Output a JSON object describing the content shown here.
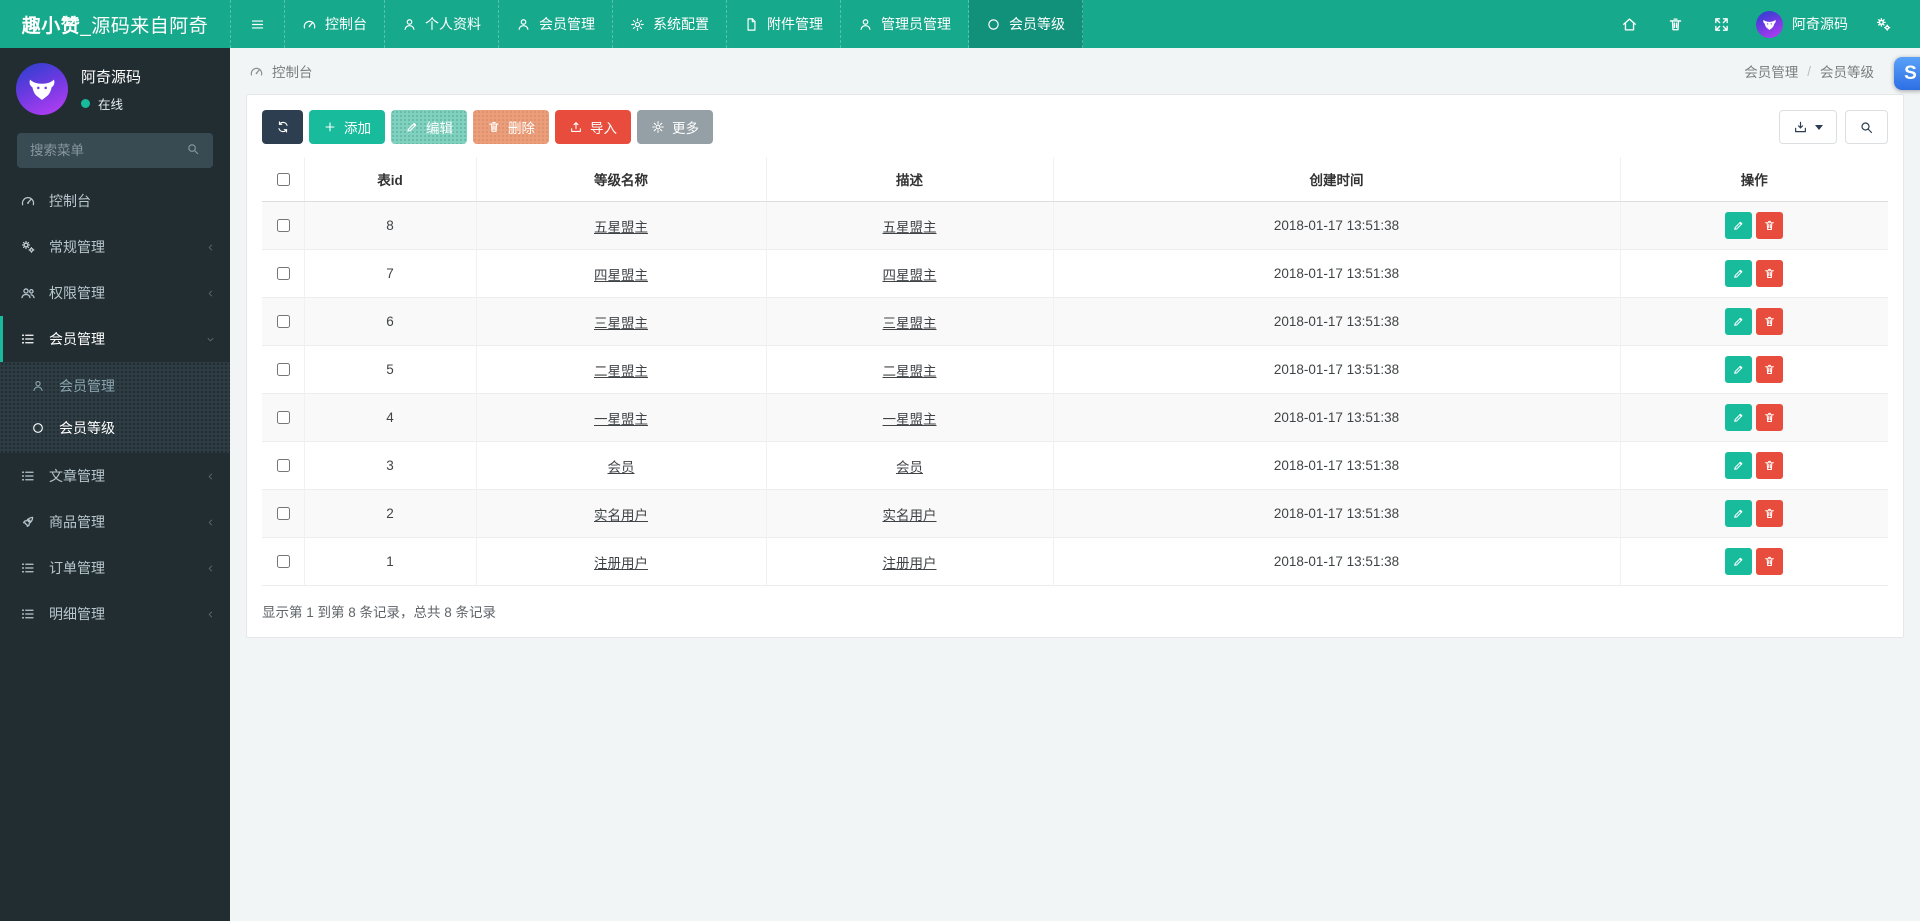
{
  "navbar": {
    "logo_bold": "趣小赞",
    "logo_rest": "_源码来自阿奇",
    "items": [
      {
        "label": "控制台",
        "icon": "dashboard",
        "active": false
      },
      {
        "label": "个人资料",
        "icon": "user",
        "active": false
      },
      {
        "label": "会员管理",
        "icon": "user",
        "active": false
      },
      {
        "label": "系统配置",
        "icon": "gear",
        "active": false
      },
      {
        "label": "附件管理",
        "icon": "file",
        "active": false
      },
      {
        "label": "管理员管理",
        "icon": "user",
        "active": false
      },
      {
        "label": "会员等级",
        "icon": "circle",
        "active": true
      }
    ],
    "user_name": "阿奇源码"
  },
  "sidebar": {
    "user_name": "阿奇源码",
    "user_status": "在线",
    "search_placeholder": "搜索菜单",
    "menu": [
      {
        "label": "控制台",
        "icon": "dashboard"
      },
      {
        "label": "常规管理",
        "icon": "gears",
        "chevron": "left"
      },
      {
        "label": "权限管理",
        "icon": "users",
        "chevron": "left"
      },
      {
        "label": "会员管理",
        "icon": "list",
        "chevron": "down",
        "active": true,
        "children": [
          {
            "label": "会员管理",
            "icon": "user",
            "active": false
          },
          {
            "label": "会员等级",
            "icon": "circle",
            "active": true
          }
        ]
      },
      {
        "label": "文章管理",
        "icon": "list",
        "chevron": "left"
      },
      {
        "label": "商品管理",
        "icon": "rocket",
        "chevron": "left"
      },
      {
        "label": "订单管理",
        "icon": "list",
        "chevron": "left"
      },
      {
        "label": "明细管理",
        "icon": "list",
        "chevron": "left"
      }
    ]
  },
  "content_header": {
    "title": "控制台",
    "separator": "/",
    "breadcrumb": [
      "会员管理",
      "会员等级"
    ]
  },
  "overlay": {
    "letter": "S"
  },
  "toolbar": {
    "add": "添加",
    "edit": "编辑",
    "delete": "删除",
    "import": "导入",
    "more": "更多"
  },
  "table": {
    "headers": [
      "表id",
      "等级名称",
      "描述",
      "创建时间",
      "操作"
    ],
    "rows": [
      {
        "id": "8",
        "name": "五星盟主",
        "desc": "五星盟主",
        "created": "2018-01-17 13:51:38"
      },
      {
        "id": "7",
        "name": "四星盟主",
        "desc": "四星盟主",
        "created": "2018-01-17 13:51:38"
      },
      {
        "id": "6",
        "name": "三星盟主",
        "desc": "三星盟主",
        "created": "2018-01-17 13:51:38"
      },
      {
        "id": "5",
        "name": "二星盟主",
        "desc": "二星盟主",
        "created": "2018-01-17 13:51:38"
      },
      {
        "id": "4",
        "name": "一星盟主",
        "desc": "一星盟主",
        "created": "2018-01-17 13:51:38"
      },
      {
        "id": "3",
        "name": "会员",
        "desc": "会员",
        "created": "2018-01-17 13:51:38"
      },
      {
        "id": "2",
        "name": "实名用户",
        "desc": "实名用户",
        "created": "2018-01-17 13:51:38"
      },
      {
        "id": "1",
        "name": "注册用户",
        "desc": "注册用户",
        "created": "2018-01-17 13:51:38"
      }
    ]
  },
  "summary": "显示第 1 到第 8 条记录，总共 8 条记录",
  "colors": {
    "topbar": "#17a98b",
    "accent": "#18bc9c",
    "danger": "#e74c3c",
    "dark": "#2c3e50"
  }
}
